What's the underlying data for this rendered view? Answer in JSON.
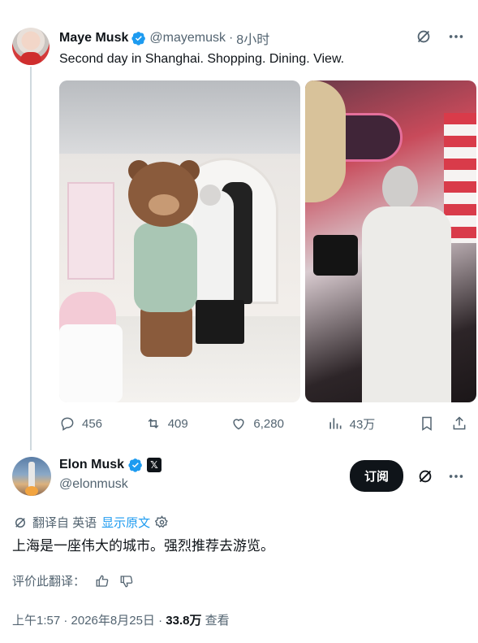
{
  "reply_tweet": {
    "author_name": "Maye Musk",
    "handle": "@mayemusk",
    "separator": "·",
    "time": "8小时",
    "text": "Second day in Shanghai. Shopping. Dining. View.",
    "actions": {
      "replies": "456",
      "retweets": "409",
      "likes": "6,280",
      "views": "43万"
    }
  },
  "main_tweet": {
    "author_name": "Elon Musk",
    "x_badge": "𝕏",
    "handle": "@elonmusk",
    "subscribe_label": "订阅",
    "translated_prefix": "翻译自 英语",
    "show_original": "显示原文",
    "text": "上海是一座伟大的城市。强烈推荐去游览。",
    "rate_translation": "评价此翻译：",
    "timestamp": "上午1:57 · 2026年8月25日 ·",
    "views_count": "33.8万",
    "views_label": "查看"
  },
  "colors": {
    "verified": "#1d9bf0",
    "secondary_text": "#536471",
    "link": "#1d9bf0",
    "primary_text": "#0f1419"
  }
}
